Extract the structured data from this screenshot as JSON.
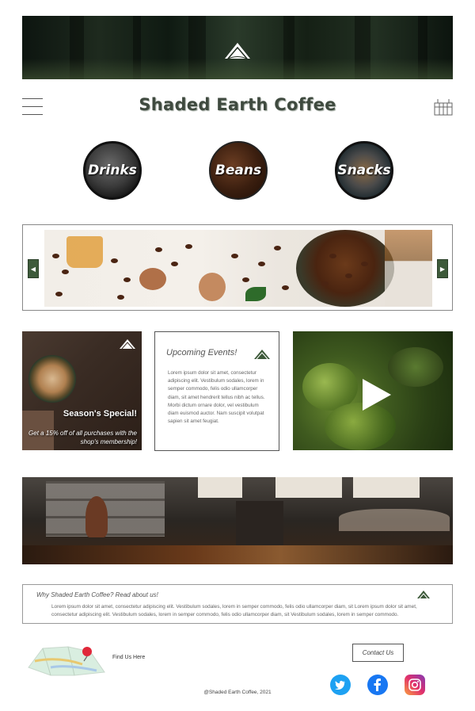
{
  "header": {
    "brand_title": "Shaded Earth Coffee",
    "hero_image": "forest-path",
    "logo_icon": "mountain-logo-icon",
    "menu_icon": "hamburger-menu-icon",
    "cart_icon": "basket-icon"
  },
  "categories": [
    {
      "label": "Drinks",
      "image": "coffee-cup"
    },
    {
      "label": "Beans",
      "image": "coffee-beans"
    },
    {
      "label": "Snacks",
      "image": "pastry"
    }
  ],
  "carousel": {
    "image": "coffee-beans-spread",
    "prev_icon": "chevron-left-icon",
    "next_icon": "chevron-right-icon"
  },
  "promo": {
    "title": "Season's Special!",
    "text": "Get a 15% off of all purchases with the shop's membership!"
  },
  "events": {
    "title": "Upcoming Events!",
    "body": "Lorem ipsum dolor sit amet, consectetur adipiscing elit. Vestibulum sodales, lorem in semper commodo, felis odio ullamcorper diam, sit amet hendrerit tellus nibh ac tellus. Morbi dictum ornare dolor, vel vestibulum diam euismod auctor. Nam suscipit volutpat sapien sit amet feugiat."
  },
  "video": {
    "image": "coffee-cherries",
    "play_icon": "play-icon"
  },
  "banner": {
    "image": "cafe-interior"
  },
  "about": {
    "title": "Why Shaded Earth Coffee? Read about us!",
    "body": "Lorem ipsum dolor sit amet, consectetur adipiscing elit. Vestibulum sodales, lorem in semper commodo, felis odio ullamcorper diam, sit Lorem ipsum dolor sit amet, consectetur adipiscing elit. Vestibulum sodales, lorem in semper commodo, felis odio ullamcorper diam, sit Vestibulum sodales, lorem in semper commodo."
  },
  "footer": {
    "find_us": "Find Us Here",
    "contact_label": "Contact Us",
    "copyright": "@Shaded Earth Coffee, 2021",
    "social": [
      "twitter-icon",
      "facebook-icon",
      "instagram-icon"
    ]
  },
  "colors": {
    "brand_green": "#3d5a3a",
    "title_gray": "#3f4a3f",
    "twitter": "#1da1f2",
    "facebook": "#1877f2"
  }
}
